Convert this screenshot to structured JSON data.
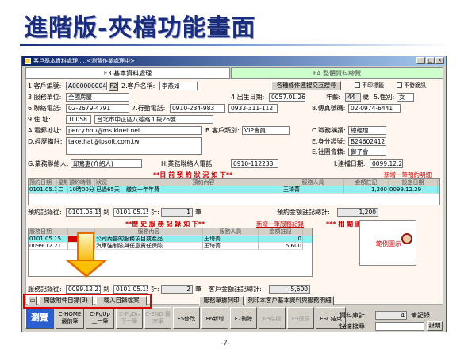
{
  "slide": {
    "title": "進階版-夾檔功能畫面",
    "page_number": "-7-"
  },
  "window": {
    "title": "客戶基本資料處理.....<瀏覽作業處理中>"
  },
  "tabs": {
    "tab1": "F3 基本資料處理",
    "tab2": "F4 整體資料總覽"
  },
  "form": {
    "l_cust_no": "1.客戶編號:",
    "cust_no": "A000000004",
    "f2_button": "F2",
    "l_cust_name": "2.客戶名稱:",
    "cust_name": "李燕如",
    "record_button": "各種條件連搜交互搜尋",
    "chk_no_mail": "不印標籤",
    "chk_no_send": "不發簡訊",
    "l_unit": "3.服務單位:",
    "unit": "全國房屋",
    "l_birth": "4.出生日期:",
    "birth": "0057.01.26",
    "l_age": "年齡:",
    "age": "44",
    "age_unit": "歲",
    "l_gender": "5.性別:",
    "gender": "女",
    "l_phone": "6.聯絡電話:",
    "phone": "02-2679-4791",
    "l_mobile": "7.行動電話:",
    "mobile": "0910-234-983",
    "mobile2": "0933-311-112",
    "l_fax": "8.傳真號碼:",
    "fax": "02-0974-6441",
    "l_address": "9.住 址:",
    "zip": "10058",
    "address": "台北市中正區八德路１段26號",
    "l_email": "A.電郵地址:",
    "email": "percy.hou@ms.kinet.net",
    "l_cust_type": "B.客戶類別:",
    "cust_type": "VIP會員",
    "l_title": "C.職務稱謂:",
    "job_title": "總經理",
    "l_note": "D.經歷備註:",
    "note": "takethat@ipsoft.com.tw",
    "l_id": "E.身分證號:",
    "id_no": "B246024122",
    "l_group": "E.社團會籍:",
    "group": "獅子會",
    "l_contact": "G.業務聯絡人:",
    "contact": "邱鶯惠(介紹人)",
    "l_contact_tel": "H.業務聯絡人電話:",
    "contact_tel": "0910-112233",
    "l_build_date": "I.建檔日期:",
    "build_date": "0099.12.21"
  },
  "booking": {
    "title": "**目 前 預 約 狀 況 如 下**",
    "new_link": "新增一筆預約明細",
    "headers": [
      "預約日期",
      "星期",
      "預約時間",
      "狀況",
      "預約內容",
      "服務人員",
      "金額註記",
      "設定日期"
    ],
    "rows": [
      [
        "0101.05.15",
        "二",
        "10時00分",
        "已過65天",
        "繳交一年年費",
        "王琦菁",
        "1,200",
        "0099.12.29"
      ]
    ],
    "l_count": "預約記錄從:",
    "from": "0101.05.15",
    "to_lbl": "到",
    "to": "0101.05.15",
    "l_total": "計:",
    "count": "1",
    "unit": "筆",
    "l_amount": "預約金額註記總計:",
    "amount": "1,200"
  },
  "history": {
    "title": "**歷 史 服 務 記 錄 如 下**",
    "new_link": "新增一筆服務記錄",
    "headers": [
      "服務日期",
      "",
      "服務內容",
      "服務人員",
      "金額註記"
    ],
    "rows": [
      [
        "0101.05.15",
        "",
        "公司內部的服務項目或產品",
        "王琦菁",
        "0"
      ],
      [
        "0099.12.21",
        "",
        "汽車強制險與任意責任保險",
        "王琦菁",
        "5,600"
      ]
    ],
    "l_count": "服務記錄從:",
    "from": "0099.12.21",
    "to_lbl": "到",
    "to": "0101.05.15",
    "l_total": "計:",
    "count": "2",
    "unit": "筆",
    "l_amount": "客戶金額註記總計:",
    "amount": "5,600"
  },
  "photo": {
    "title": "***  相 關 圖 片  ***",
    "sample_text": "範例圖示"
  },
  "attach": {
    "open_button": "開啟附件目錄(3)",
    "import_button": "載入目錄檔案",
    "service_report": "服務單據列印",
    "print_all": "列印本客戶基本資料與服務明細"
  },
  "toolbar": {
    "browse": "瀏覽",
    "home": "C-HOME 最前筆",
    "pgup": "C-PgUp 上一筆",
    "pgdn": "C-PgDn 下一筆",
    "end": "C-END 最末筆",
    "f5": "F5修改",
    "f6": "F6新增",
    "f7": "F7刪除",
    "f8": "F8存檔",
    "f9": "F9還原",
    "esc": "ESC結束",
    "l_records": "資料庫計:",
    "records": "4",
    "records_unit": "筆記錄",
    "l_search": "快速搜尋:",
    "explain": "說明"
  }
}
